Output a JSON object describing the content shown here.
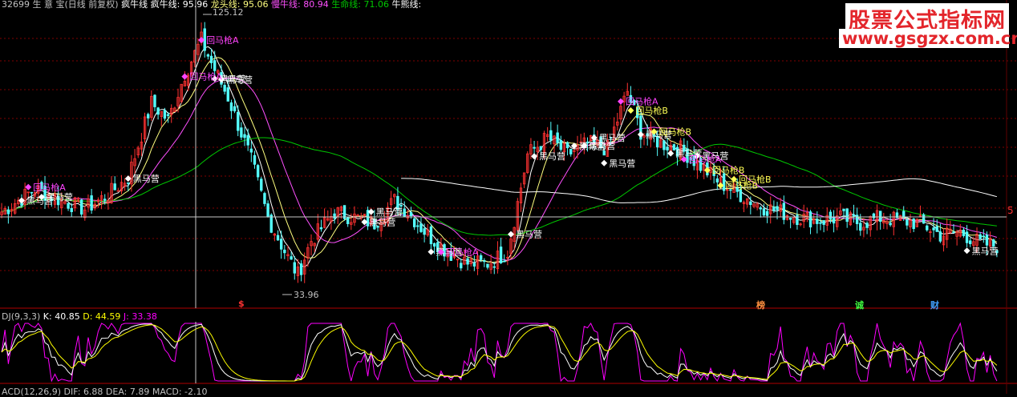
{
  "header": {
    "code": "32699",
    "name": "生 意 宝(日线 前复权)",
    "line1_label": "疯牛线",
    "line2_label": "疯牛线:",
    "line2_value": "95.96",
    "line3_label": "龙头线:",
    "line3_value": "95.06",
    "line4_label": "慢牛线:",
    "line4_value": "80.94",
    "line5_label": "生命线:",
    "line5_value": "71.06",
    "line6_label": "牛熊线:",
    "line6_value": ""
  },
  "kdj_header": {
    "name": "DJ(9,3,3)",
    "k_label": "K:",
    "k_value": "40.85",
    "d_label": "D:",
    "d_value": "44.59",
    "j_label": "J:",
    "j_value": "33.38"
  },
  "macd_header": "ACD(12,26,9)  DIF: 6.88  DEA: 7.89  MACD: -2.10",
  "watermark": {
    "line1": "股票公式指标网",
    "line2": "www.gsgzx.com.cn"
  },
  "price_scale_right": "5",
  "event_cues": [
    "$",
    "榜",
    "诚",
    "财"
  ],
  "colors": {
    "bg": "#000000",
    "up": "#ff3232",
    "down": "#54ffff",
    "ma_fast": "#ffffff",
    "ma_mid": "#ffff80",
    "ma_slow": "#ff50ff",
    "life": "#00c800",
    "signal_white": "#ffffff",
    "signal_magenta": "#ff44ff",
    "signal_yellow": "#ffff55",
    "kdj_k": "#ffffff",
    "kdj_d": "#ffff00",
    "kdj_j": "#ff00ff",
    "grid": "#800000",
    "crosshair": "#c8c8c8"
  },
  "chart_data": {
    "type": "candlestick",
    "title": "",
    "price_range": [
      30,
      130
    ],
    "highest_label": "125.12",
    "lowest_label": "33.96",
    "signal_labels": {
      "black_horse": "黑马营",
      "grab_a": "回马枪A",
      "grab_b": "回马枪B"
    },
    "signals": [
      {
        "type": "black_horse",
        "bar": 6
      },
      {
        "type": "black_horse",
        "bar": 12
      },
      {
        "type": "black_horse",
        "bar": 38
      },
      {
        "type": "black_horse",
        "bar": 64
      },
      {
        "type": "black_horse",
        "bar": 66
      },
      {
        "type": "black_horse",
        "bar": 109
      },
      {
        "type": "black_horse",
        "bar": 111
      },
      {
        "type": "black_horse",
        "bar": 129
      },
      {
        "type": "black_horse",
        "bar": 153
      },
      {
        "type": "black_horse",
        "bar": 160
      },
      {
        "type": "black_horse",
        "bar": 172
      },
      {
        "type": "black_horse",
        "bar": 175
      },
      {
        "type": "black_horse",
        "bar": 178
      },
      {
        "type": "black_horse",
        "bar": 181
      },
      {
        "type": "black_horse",
        "bar": 192
      },
      {
        "type": "black_horse",
        "bar": 201
      },
      {
        "type": "black_horse",
        "bar": 209
      },
      {
        "type": "black_horse",
        "bar": 290
      },
      {
        "type": "grab_a",
        "bar": 8
      },
      {
        "type": "grab_a",
        "bar": 60
      },
      {
        "type": "grab_a",
        "bar": 55
      },
      {
        "type": "grab_a",
        "bar": 132
      },
      {
        "type": "grab_a",
        "bar": 186
      },
      {
        "type": "grab_a",
        "bar": 205
      },
      {
        "type": "grab_b",
        "bar": 212
      },
      {
        "type": "grab_b",
        "bar": 216
      },
      {
        "type": "grab_b",
        "bar": 196
      },
      {
        "type": "grab_b",
        "bar": 189
      },
      {
        "type": "grab_b",
        "bar": 220
      }
    ]
  }
}
